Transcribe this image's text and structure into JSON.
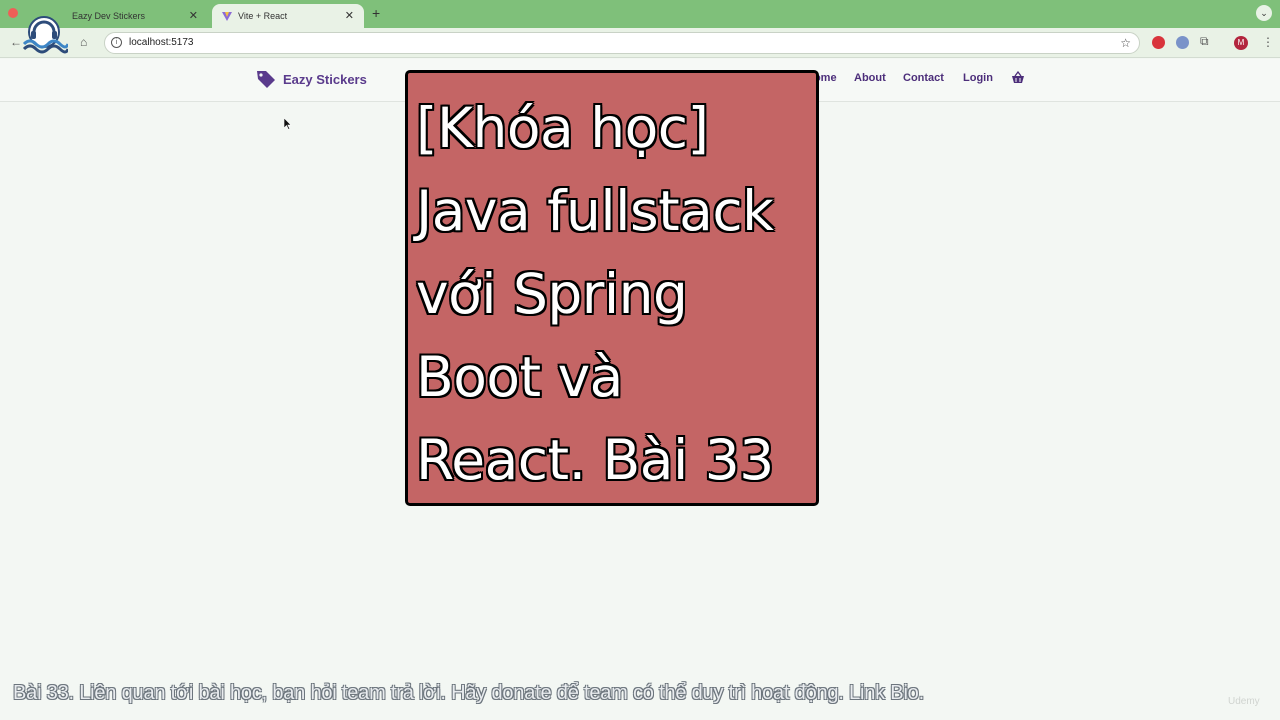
{
  "browser": {
    "tabs": [
      {
        "title": "Eazy Dev Stickers",
        "active": false
      },
      {
        "title": "Vite + React",
        "active": true
      }
    ],
    "new_tab_label": "+",
    "url": "localhost:5173",
    "profile_initial": "M"
  },
  "site": {
    "brand": "Eazy Stickers",
    "nav": [
      "Home",
      "About",
      "Contact",
      "Login"
    ]
  },
  "banner": {
    "lines": [
      "[Khóa học]",
      "Java fullstack",
      "với Spring",
      "Boot và",
      "React. Bài 33"
    ],
    "background": "#c46565"
  },
  "caption": "Bài 33. Liên quan tới bài học, bạn hỏi team trả lời. Hãy donate để team có thể duy trì hoạt động. Link Bio.",
  "watermark": "Udemy",
  "colors": {
    "tab_bar": "#7fc07a",
    "toolbar": "#e9f2e6",
    "brand_purple": "#5a3b8c"
  }
}
